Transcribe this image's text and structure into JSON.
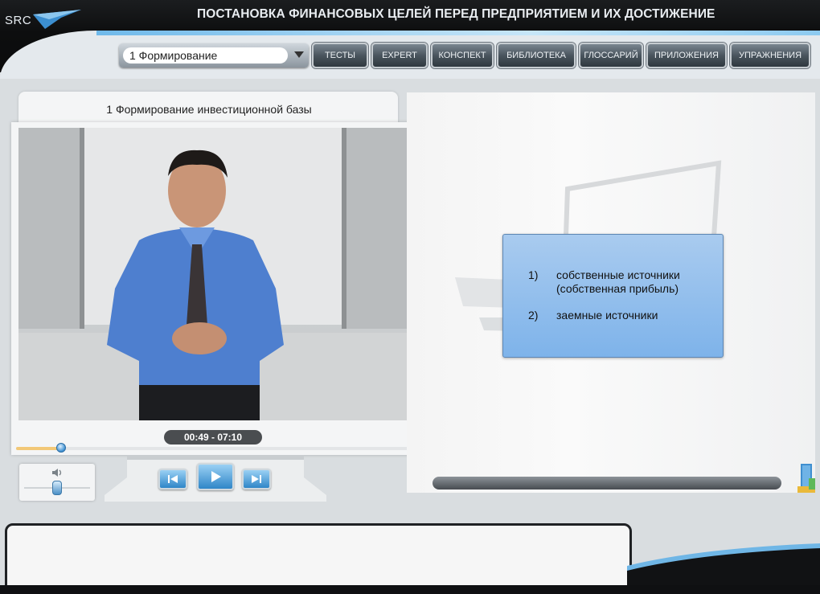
{
  "header": {
    "logo_text": "SRC",
    "title": "ПОСТАНОВКА ФИНАНСОВЫХ ЦЕЛЕЙ ПЕРЕД ПРЕДПРИЯТИЕМ И ИХ ДОСТИЖЕНИЕ"
  },
  "nav": {
    "chapter_select": "1 Формирование",
    "buttons": [
      "ТЕСТЫ",
      "EXPERT",
      "КОНСПЕКТ",
      "БИБЛИОТЕКА",
      "ГЛОССАРИЙ",
      "ПРИЛОЖЕНИЯ",
      "УПРАЖНЕНИЯ"
    ]
  },
  "player": {
    "video_title": "1 Формирование инвестиционной базы",
    "time": "00:49 - 07:10",
    "progress_fraction": 0.114,
    "volume_fraction": 0.5
  },
  "slide": {
    "items": [
      {
        "num": "1)",
        "text_line1": "собственные источники",
        "text_line2": "(собственная прибыль)"
      },
      {
        "num": "2)",
        "text_line1": "заемные источники",
        "text_line2": ""
      }
    ]
  },
  "icons": {
    "prev": "skip-back-icon",
    "play": "play-icon",
    "next": "skip-forward-icon",
    "volume": "speaker-icon"
  },
  "colors": {
    "accent_blue": "#3b8fd1",
    "progress_fill": "#f2c877",
    "content_box": "#8fbdec"
  }
}
